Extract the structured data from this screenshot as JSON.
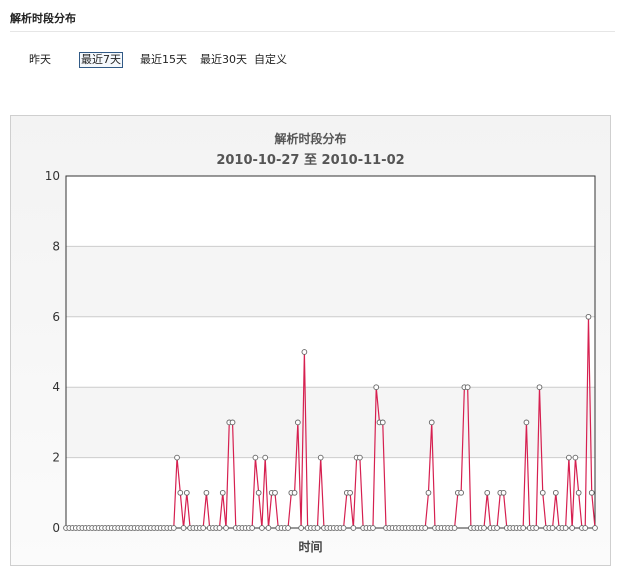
{
  "section_title": "解析时段分布",
  "ranges": [
    {
      "label": "昨天",
      "selected": false
    },
    {
      "label": "最近7天",
      "selected": true
    },
    {
      "label": "最近15天",
      "selected": false
    },
    {
      "label": "最近30天",
      "selected": false
    },
    {
      "label": "自定义",
      "selected": false
    }
  ],
  "colors": {
    "line": "#d62050",
    "marker_fill": "#ffffff",
    "marker_stroke": "#666666",
    "plot_band": "#f5f5f5",
    "plot_bg": "#ffffff",
    "grid": "#cccccc",
    "axis": "#333333"
  },
  "chart_data": {
    "type": "line",
    "title": "解析时段分布",
    "subtitle": "2010-10-27 至 2010-11-02",
    "xlabel": "时间",
    "ylabel": "",
    "ylim": [
      0,
      10
    ],
    "yticks": [
      0,
      2,
      4,
      6,
      8,
      10
    ],
    "grid": true,
    "alternating_bands": true,
    "markers": "circle",
    "series": [
      {
        "values": [
          0,
          0,
          0,
          0,
          0,
          0,
          0,
          0,
          0,
          0,
          0,
          0,
          0,
          0,
          0,
          0,
          0,
          0,
          0,
          0,
          0,
          0,
          0,
          0,
          0,
          0,
          0,
          0,
          0,
          0,
          0,
          0,
          0,
          0,
          2,
          1,
          0,
          1,
          0,
          0,
          0,
          0,
          0,
          1,
          0,
          0,
          0,
          0,
          1,
          0,
          3,
          3,
          0,
          0,
          0,
          0,
          0,
          0,
          2,
          1,
          0,
          2,
          0,
          1,
          1,
          0,
          0,
          0,
          0,
          1,
          1,
          3,
          0,
          5,
          0,
          0,
          0,
          0,
          2,
          0,
          0,
          0,
          0,
          0,
          0,
          0,
          1,
          1,
          0,
          2,
          2,
          0,
          0,
          0,
          0,
          4,
          3,
          3,
          0,
          0,
          0,
          0,
          0,
          0,
          0,
          0,
          0,
          0,
          0,
          0,
          0,
          1,
          3,
          0,
          0,
          0,
          0,
          0,
          0,
          0,
          1,
          1,
          4,
          4,
          0,
          0,
          0,
          0,
          0,
          1,
          0,
          0,
          0,
          1,
          1,
          0,
          0,
          0,
          0,
          0,
          0,
          3,
          0,
          0,
          0,
          4,
          1,
          0,
          0,
          0,
          1,
          0,
          0,
          0,
          2,
          0,
          2,
          1,
          0,
          0,
          6,
          1,
          0
        ]
      }
    ]
  }
}
